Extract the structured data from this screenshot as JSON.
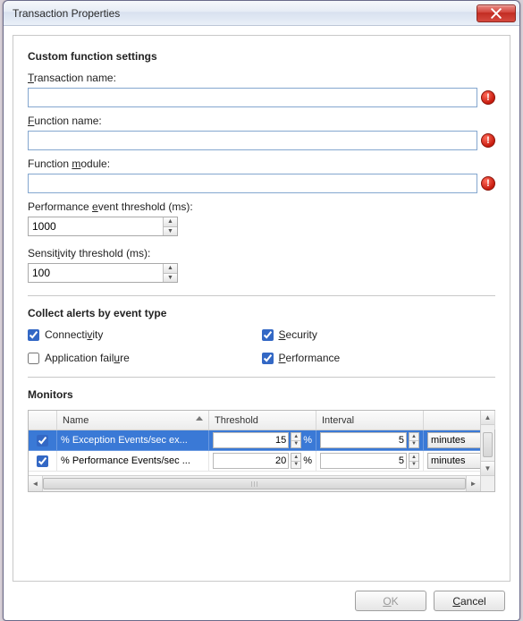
{
  "window": {
    "title": "Transaction Properties"
  },
  "sections": {
    "custom": "Custom function settings",
    "alerts": "Collect alerts by event type",
    "monitors": "Monitors"
  },
  "labels": {
    "transaction_name": "Transaction name:",
    "function_name": "Function name:",
    "function_module": "Function module:",
    "perf_threshold": "Performance event threshold (ms):",
    "sens_threshold": "Sensitivity threshold (ms):"
  },
  "fields": {
    "transaction_name": "",
    "function_name": "",
    "function_module": "",
    "perf_threshold": "1000",
    "sens_threshold": "100"
  },
  "errors": {
    "transaction_name": true,
    "function_name": true,
    "function_module": true
  },
  "alerts": {
    "connectivity": {
      "label": "Connectivity",
      "checked": true
    },
    "security": {
      "label": "Security",
      "checked": true
    },
    "app_failure": {
      "label": "Application failure",
      "checked": false
    },
    "performance": {
      "label": "Performance",
      "checked": true
    }
  },
  "monitors": {
    "columns": {
      "name": "Name",
      "threshold": "Threshold",
      "interval": "Interval"
    },
    "rows": [
      {
        "checked": true,
        "name": "% Exception Events/sec ex...",
        "threshold": "15",
        "threshold_unit": "%",
        "interval": "5",
        "interval_unit": "minutes",
        "selected": true
      },
      {
        "checked": true,
        "name": "% Performance Events/sec ...",
        "threshold": "20",
        "threshold_unit": "%",
        "interval": "5",
        "interval_unit": "minutes",
        "selected": false
      }
    ]
  },
  "buttons": {
    "ok": "OK",
    "cancel": "Cancel"
  },
  "underline_hints": {
    "transaction_name": "T",
    "function_name": "F",
    "function_module": "m",
    "perf_threshold": "e",
    "sens_threshold": "i",
    "connectivity": "v",
    "security": "S",
    "app_failure": "u",
    "performance": "P",
    "ok": "O",
    "cancel": "C"
  }
}
